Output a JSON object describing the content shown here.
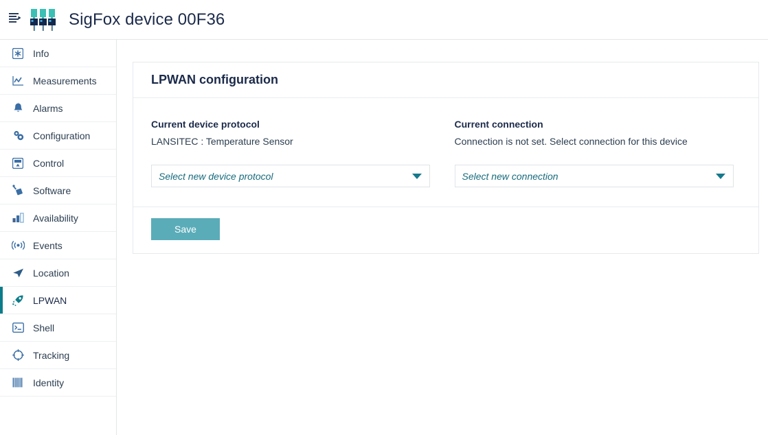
{
  "header": {
    "menu_icon": "list-collapse-icon",
    "logo_icon": "device-pins-logo",
    "title": "SigFox device 00F36"
  },
  "sidebar": {
    "items": [
      {
        "label": "Info",
        "icon": "info-asterisk-icon",
        "active": false
      },
      {
        "label": "Measurements",
        "icon": "line-chart-icon",
        "active": false
      },
      {
        "label": "Alarms",
        "icon": "bell-icon",
        "active": false
      },
      {
        "label": "Configuration",
        "icon": "gears-icon",
        "active": false
      },
      {
        "label": "Control",
        "icon": "control-panel-icon",
        "active": false
      },
      {
        "label": "Software",
        "icon": "software-chip-icon",
        "active": false
      },
      {
        "label": "Availability",
        "icon": "bar-chart-icon",
        "active": false
      },
      {
        "label": "Events",
        "icon": "broadcast-icon",
        "active": false
      },
      {
        "label": "Location",
        "icon": "navigation-arrow-icon",
        "active": false
      },
      {
        "label": "LPWAN",
        "icon": "rocket-icon",
        "active": true
      },
      {
        "label": "Shell",
        "icon": "terminal-icon",
        "active": false
      },
      {
        "label": "Tracking",
        "icon": "crosshair-circle-icon",
        "active": false
      },
      {
        "label": "Identity",
        "icon": "barcode-icon",
        "active": false
      }
    ]
  },
  "card": {
    "title": "LPWAN configuration",
    "left_column": {
      "label": "Current device protocol",
      "value": "LANSITEC : Temperature Sensor",
      "select": {
        "placeholder": "Select new device protocol",
        "value": "",
        "caret_icon": "chevron-down-icon"
      }
    },
    "right_column": {
      "label": "Current connection",
      "value": "Connection is not set. Select connection for this device",
      "select": {
        "placeholder": "Select new connection",
        "value": "",
        "caret_icon": "chevron-down-icon"
      }
    },
    "save_label": "Save"
  },
  "colors": {
    "accent_teal": "#0d7c8a",
    "button_teal": "#5aacb8",
    "logo_teal": "#3cbfb5",
    "logo_navy": "#12284c",
    "text_navy": "#1b2a4a",
    "icon_blue": "#3a6ea5",
    "border_grey": "#e3e6e8"
  }
}
